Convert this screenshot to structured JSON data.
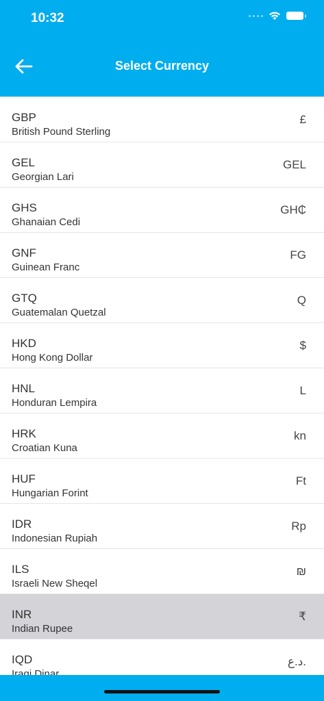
{
  "status_bar": {
    "time": "10:32"
  },
  "header": {
    "title": "Select Currency",
    "back_icon": "arrow-left-icon",
    "color": "#00adef"
  },
  "currencies": [
    {
      "code": "GBP",
      "name": "British Pound Sterling",
      "symbol": "£"
    },
    {
      "code": "GEL",
      "name": "Georgian Lari",
      "symbol": "GEL"
    },
    {
      "code": "GHS",
      "name": "Ghanaian Cedi",
      "symbol": "GH₵"
    },
    {
      "code": "GNF",
      "name": "Guinean Franc",
      "symbol": "FG"
    },
    {
      "code": "GTQ",
      "name": "Guatemalan Quetzal",
      "symbol": "Q"
    },
    {
      "code": "HKD",
      "name": "Hong Kong Dollar",
      "symbol": "$"
    },
    {
      "code": "HNL",
      "name": "Honduran Lempira",
      "symbol": "L"
    },
    {
      "code": "HRK",
      "name": "Croatian Kuna",
      "symbol": "kn"
    },
    {
      "code": "HUF",
      "name": "Hungarian Forint",
      "symbol": "Ft"
    },
    {
      "code": "IDR",
      "name": "Indonesian Rupiah",
      "symbol": "Rp"
    },
    {
      "code": "ILS",
      "name": "Israeli New Sheqel",
      "symbol": "₪"
    },
    {
      "code": "INR",
      "name": "Indian Rupee",
      "symbol": "₹",
      "selected": true
    },
    {
      "code": "IQD",
      "name": "Iraqi Dinar",
      "symbol": "د.ع."
    }
  ]
}
